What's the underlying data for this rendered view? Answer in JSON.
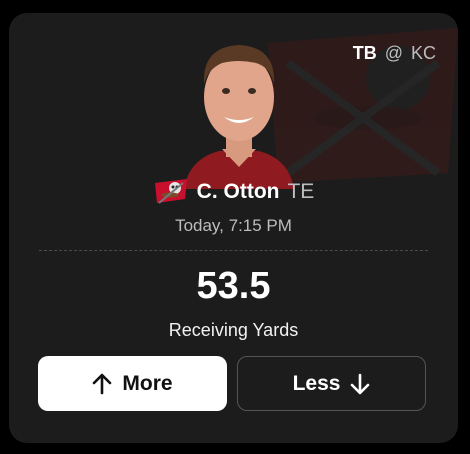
{
  "matchup": {
    "home": "TB",
    "at": "@",
    "away": "KC"
  },
  "player": {
    "name": "C. Otton",
    "position": "TE",
    "team_logo_icon": "buccaneers-logo-icon"
  },
  "game": {
    "time": "Today, 7:15 PM"
  },
  "projection": {
    "line": "53.5",
    "stat": "Receiving Yards"
  },
  "actions": {
    "more_label": "More",
    "less_label": "Less"
  },
  "colors": {
    "card_bg": "#1c1c1c",
    "accent_red": "#c8102e",
    "text_secondary": "#bdbdbd"
  }
}
